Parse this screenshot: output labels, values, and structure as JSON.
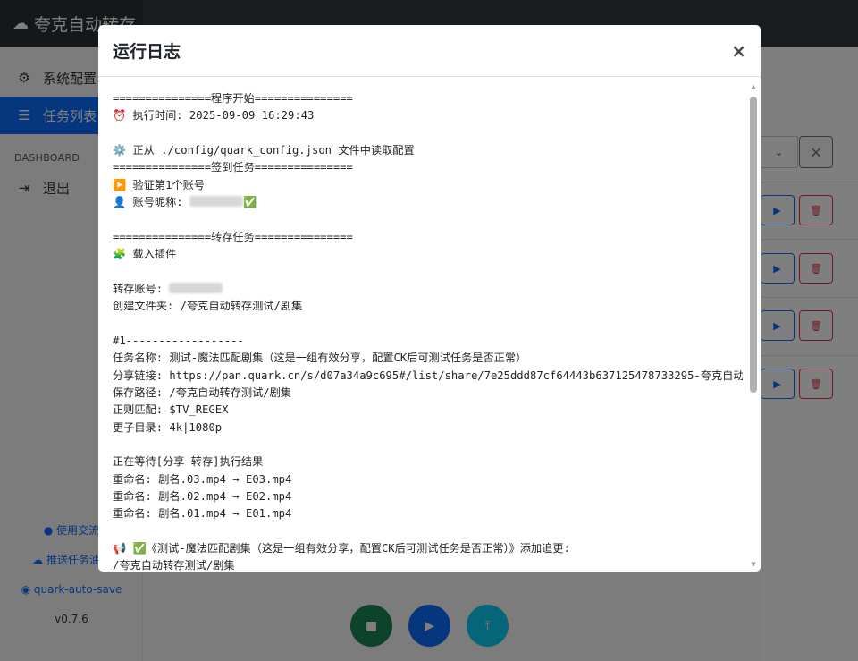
{
  "app": {
    "brand": "夸克自动转存",
    "sidebar": [
      {
        "label": "系统配置",
        "icon": "gear-icon"
      },
      {
        "label": "任务列表",
        "icon": "list-icon"
      }
    ],
    "section_heading": "DASHBOARD",
    "logout": "退出",
    "bottom_links": [
      "使用交流",
      "推送任务油猴",
      "quark-auto-save"
    ],
    "version": "v0.7.6"
  },
  "modal": {
    "title": "运行日志",
    "close": "×",
    "lines": [
      "===============程序开始===============",
      "⏰ 执行时间: 2025-09-09 16:29:43",
      "",
      "⚙️ 正从 ./config/quark_config.json 文件中读取配置",
      "===============签到任务===============",
      "▶️ 验证第1个账号",
      "👤 账号昵称: ",
      "",
      "===============转存任务===============",
      "🧩 载入插件",
      "",
      "转存账号: ",
      "创建文件夹: /夸克自动转存测试/剧集",
      "",
      "#1------------------",
      "任务名称: 测试-魔法匹配剧集（这是一组有效分享，配置CK后可测试任务是否正常）",
      "分享链接: https://pan.quark.cn/s/d07a34a9c695#/list/share/7e25ddd87cf64443b637125478733295-夸克自动",
      "保存路径: /夸克自动转存测试/剧集",
      "正则匹配: $TV_REGEX",
      "更子目录: 4k|1080p",
      "",
      "正在等待[分享-转存]执行结果",
      "重命名: 剧名.03.mp4 → E03.mp4",
      "重命名: 剧名.02.mp4 → E02.mp4",
      "重命名: 剧名.01.mp4 → E01.mp4",
      "",
      "📢 ✅《测试-魔法匹配剧集（这是一组有效分享，配置CK后可测试任务是否正常）》添加追更:",
      "/夸克自动转存测试/剧集"
    ]
  }
}
